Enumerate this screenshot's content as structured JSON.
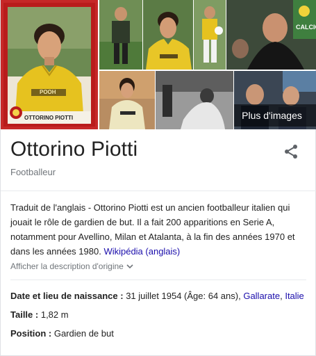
{
  "images": {
    "more_label": "Plus d'images",
    "card_name": "OTTORINO PIOTTI",
    "sponsor": "POOH",
    "banner": "CALCIO"
  },
  "header": {
    "title": "Ottorino Piotti",
    "subtitle": "Footballeur"
  },
  "description": {
    "text": "Traduit de l'anglais - Ottorino Piotti est un ancien footballeur italien qui jouait le rôle de gardien de but. Il a fait 200 apparitions en Serie A, notamment pour Avellino, Milan et Atalanta, à la fin des années 1970 et dans les années 1980. ",
    "source_link": "Wikipédia (anglais)",
    "original_toggle": "Afficher la description d'origine"
  },
  "facts": [
    {
      "label": "Date et lieu de naissance :",
      "value": "31 juillet 1954 (Âge: 64 ans),",
      "link1": "Gallarate",
      "sep": ",",
      "link2": "Italie"
    },
    {
      "label": "Taille :",
      "value": "1,82 m"
    },
    {
      "label": "Position :",
      "value": "Gardien de but"
    }
  ],
  "colors": {
    "link": "#1a0dab",
    "muted": "#70757a",
    "accent_red": "#c62828",
    "shirt_yellow": "#e6c21f"
  },
  "icons": {
    "share": "share-icon",
    "chevron": "chevron-down-icon"
  }
}
